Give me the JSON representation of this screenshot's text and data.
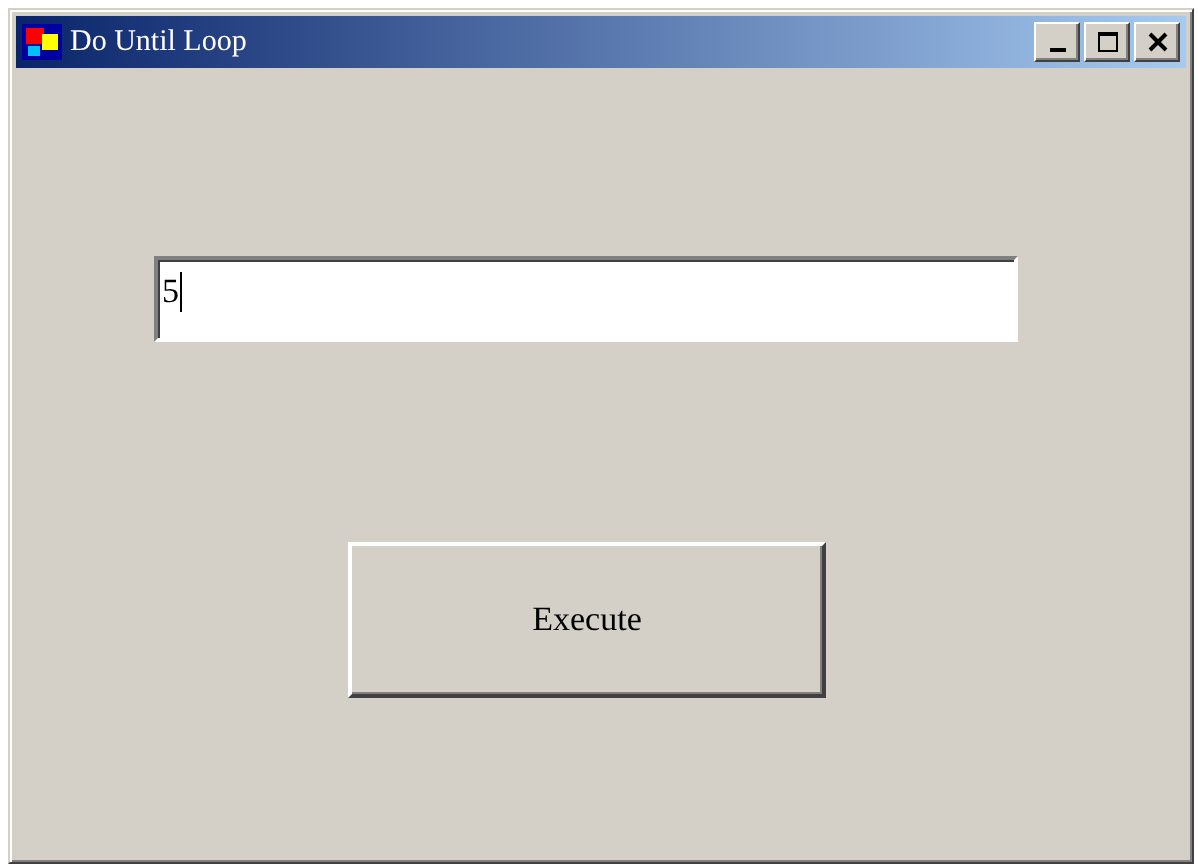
{
  "window": {
    "title": "Do Until Loop"
  },
  "input": {
    "value": "5"
  },
  "buttons": [
    {
      "label": "Execute"
    }
  ]
}
